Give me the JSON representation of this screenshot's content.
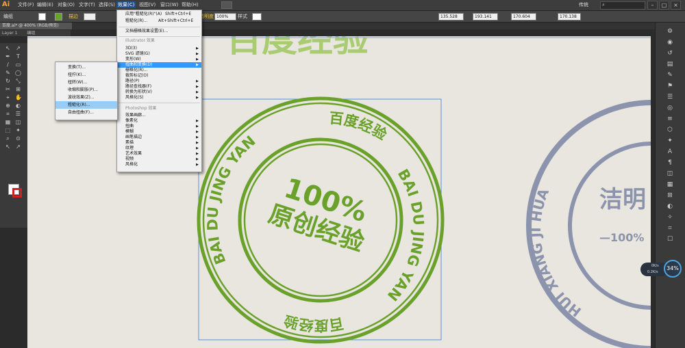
{
  "app": {
    "logo": "Ai"
  },
  "menubar": [
    "文件(F)",
    "编辑(E)",
    "对象(O)",
    "文字(T)",
    "选择(S)",
    "效果(C)",
    "视图(V)",
    "窗口(W)",
    "帮助(H)"
  ],
  "workspace": "传统",
  "controlbar": {
    "selection_label": "编组",
    "stroke_label": "描边",
    "opacity_label": "不透明度",
    "opacity_value": "100%",
    "style_label": "样式",
    "x_value": "135.528",
    "y_value": "193.141",
    "w_value": "170.604",
    "h_value": "170.138"
  },
  "document": {
    "tab_title": "百度.ai* @ 400% (RGB/预览)",
    "layer_label": "Layer 1",
    "group_label": "编组"
  },
  "effect_menu": {
    "apply_last": {
      "label": "应用\"粗糙化(R)\"(A)",
      "shortcut": "Shift+Ctrl+E"
    },
    "last_effect": {
      "label": "粗糙化(R)...",
      "shortcut": "Alt+Shift+Ctrl+E"
    },
    "doc_raster": "文档栅格效果设置(E)...",
    "illustrator_header": "Illustrator 效果",
    "illustrator_items": [
      "3D(3)",
      "SVG 滤镜(G)",
      "变形(W)",
      "扭曲和变换(D)",
      "栅格化(R)...",
      "裁剪标记(O)",
      "路径(P)",
      "路径查找器(F)",
      "转换为形状(V)",
      "风格化(S)"
    ],
    "photoshop_header": "Photoshop 效果",
    "photoshop_items": [
      "效果画廊...",
      "像素化",
      "扭曲",
      "模糊",
      "画笔描边",
      "素描",
      "纹理",
      "艺术效果",
      "视频",
      "风格化"
    ]
  },
  "distort_submenu": [
    "变换(T)...",
    "扭拧(K)...",
    "扭转(W)...",
    "收缩和膨胀(P)...",
    "波纹效果(Z)...",
    "粗糙化(R)...",
    "自由扭曲(F)..."
  ],
  "stamp": {
    "outer_text_left": "BAI DU JING YAN",
    "outer_text_top": "百度经验",
    "outer_text_right": "BAI DU JING YAN",
    "bottom_text": "百度经验",
    "center_line1": "100%",
    "center_line2": "原创经验",
    "color": "#6aa12a"
  },
  "stamp2": {
    "arc_text": "HUI XIANG JI HUA",
    "center_text": "洁明",
    "percent": "—100%",
    "color": "#8c93ad"
  },
  "banner_text": "百度经验",
  "widget": {
    "percent": "34%",
    "up": "0K/s",
    "down": "0.2K/s"
  },
  "colors": {
    "stamp_green": "#6aa12a",
    "stamp_grey": "#8c93ad",
    "menu_selected": "#3399ff",
    "submenu_selected": "#99ccf5"
  }
}
